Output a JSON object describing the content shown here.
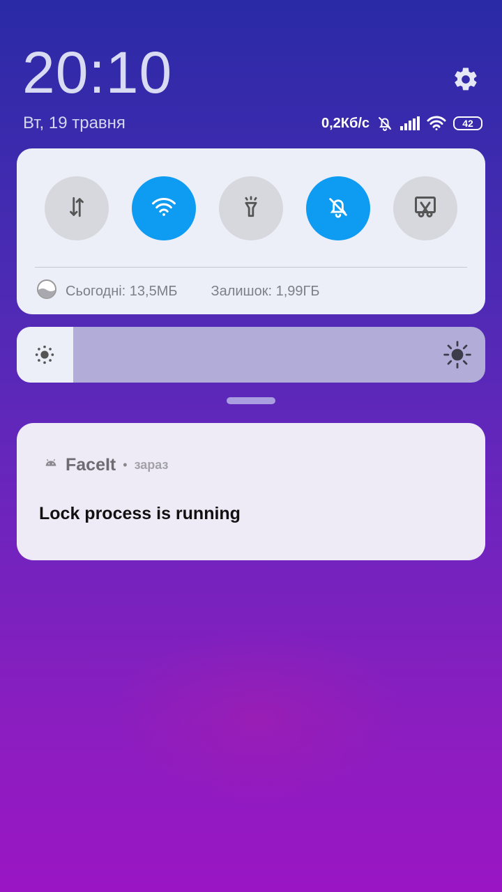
{
  "header": {
    "time": "20:10",
    "date": "Вт, 19 травня"
  },
  "status_bar": {
    "network_speed": "0,2Кб/с",
    "battery": "42",
    "icons": [
      "bell-off-icon",
      "signal-icon",
      "wifi-icon",
      "battery-icon"
    ]
  },
  "quick_settings": {
    "toggles": [
      {
        "name": "mobile-data",
        "icon": "data-transfer-icon",
        "state": "off"
      },
      {
        "name": "wifi",
        "icon": "wifi-icon",
        "state": "on"
      },
      {
        "name": "flashlight",
        "icon": "flashlight-icon",
        "state": "off"
      },
      {
        "name": "silent",
        "icon": "bell-off-icon",
        "state": "on"
      },
      {
        "name": "screenshot",
        "icon": "screenshot-icon",
        "state": "off"
      }
    ],
    "usage_today": "Сьогодні: 13,5МБ",
    "usage_remaining": "Залишок: 1,99ГБ"
  },
  "brightness": {
    "level": 0.12
  },
  "notification": {
    "app_name": "FaceIt",
    "time": "зараз",
    "title": "Lock process is running"
  },
  "colors": {
    "accent": "#0e9bf2",
    "toggle_off": "#d7d7de",
    "panel_bg": "#eceef8"
  }
}
